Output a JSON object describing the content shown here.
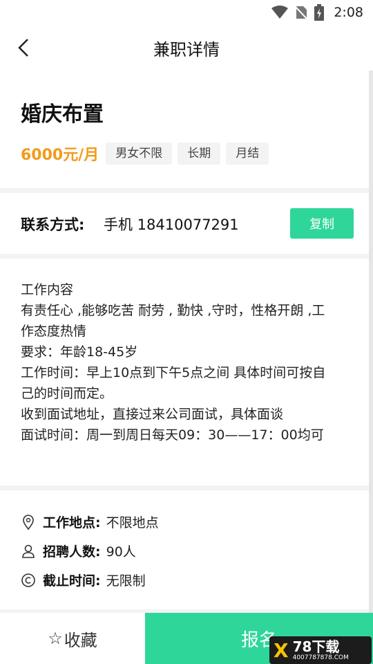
{
  "status_bar": {
    "time": "2:08"
  },
  "header": {
    "title": "兼职详情"
  },
  "job": {
    "title": "婚庆布置",
    "salary": "6000元/月",
    "tags": [
      "男女不限",
      "长期",
      "月结"
    ]
  },
  "contact": {
    "label": "联系方式:",
    "value": "手机 18410077291",
    "copy_label": "复制"
  },
  "description": {
    "lines": [
      "工作内容",
      "有责任心 ,能够吃苦 耐劳 , 勤快 ,守时，性格开朗 ,工",
      "作态度热情",
      "要求：年龄18-45岁",
      "工作时间：早上10点到下午5点之间 具体时间可按自",
      "己的时间而定。",
      "收到面试地址，直接过来公司面试，具体面谈",
      "面试时间：周一到周日每天09：30——17：00均可"
    ]
  },
  "info": {
    "location": {
      "label": "工作地点:",
      "value": "不限地点",
      "icon": "location-pin-icon"
    },
    "headcount": {
      "label": "招聘人数:",
      "value": "90人",
      "icon": "person-icon"
    },
    "deadline": {
      "label": "截止时间:",
      "value": "无限制",
      "icon": "clock-icon"
    }
  },
  "bottom": {
    "favorite_label": "收藏",
    "signup_label": "报名"
  },
  "watermark": {
    "logo_text": "78下载",
    "url": "4007787878.COM"
  },
  "colors": {
    "accent": "#2fd69a",
    "salary": "#f39a1c"
  }
}
